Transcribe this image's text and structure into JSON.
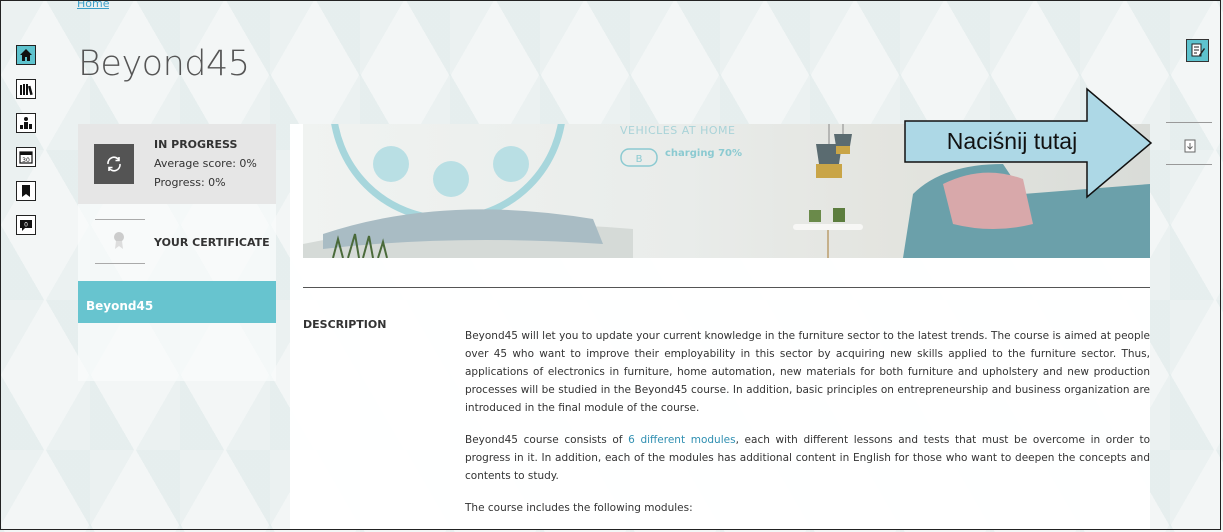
{
  "breadcrumb": {
    "home": "Home"
  },
  "iconbar": {
    "items": [
      {
        "icon": "home-icon"
      },
      {
        "icon": "books-icon"
      },
      {
        "icon": "podium-icon"
      },
      {
        "icon": "calendar-icon",
        "label": "30"
      },
      {
        "icon": "bookmark-icon"
      },
      {
        "icon": "chat-icon",
        "label": "0"
      }
    ]
  },
  "page": {
    "title": "Beyond45"
  },
  "status": {
    "title": "IN PROGRESS",
    "average_score": "Average score: 0%",
    "progress": "Progress: 0%"
  },
  "certificate": {
    "label": "YOUR CERTIFICATE"
  },
  "course_tab": {
    "label": "Beyond45"
  },
  "banner": {
    "vehicles_text": "VEHICLES AT HOME",
    "charging_text": "charging 70%",
    "badge": "B"
  },
  "description": {
    "label": "DESCRIPTION",
    "p1": "Beyond45  will let you to update your current knowledge in the furniture sector to the latest trends. The course is aimed at people over 45 who want to improve their employability in this sector by acquiring new skills applied to the furniture sector. Thus, applications of electronics in furniture, home automation, new materials for both furniture and upholstery and new production processes will be studied in the Beyond45 course. In addition, basic principles on entrepreneurship and business organization are introduced in the final module of the course.",
    "p2_before": "Beyond45 course consists of ",
    "p2_highlight": "6 different modules",
    "p2_after": ", each with different lessons and tests that must be overcome in order to progress in it. In addition, each of the modules has additional content in English for those who want to deepen the concepts and contents to study.",
    "p3": "The course includes the following modules:"
  },
  "callout": {
    "text": "Naciśnij tutaj"
  },
  "colors": {
    "accent": "#5ec3ce",
    "tab": "#67c4cf",
    "status_bg": "#e6e6e6",
    "link": "#2f8fb1"
  }
}
